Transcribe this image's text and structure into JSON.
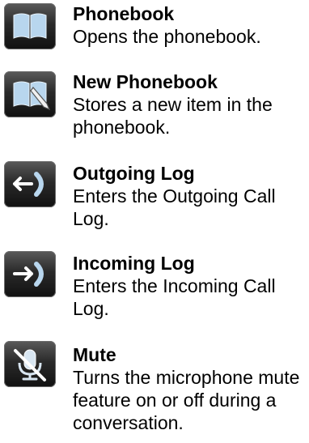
{
  "items": [
    {
      "title": "Phonebook",
      "desc": "Opens the phonebook.",
      "icon": "book-icon"
    },
    {
      "title": "New Phonebook",
      "desc": "Stores a new item in the phonebook.",
      "icon": "book-pencil-icon"
    },
    {
      "title": "Outgoing Log",
      "desc": "Enters the Outgoing Call Log.",
      "icon": "outgoing-call-icon"
    },
    {
      "title": "Incoming Log",
      "desc": "Enters the Incoming Call Log.",
      "icon": "incoming-call-icon"
    },
    {
      "title": "Mute",
      "desc": "Turns the microphone mute feature on or off during a conversation.",
      "icon": "mute-microphone-icon"
    }
  ],
  "colors": {
    "icon_bg": "#2a2a2a",
    "icon_accent": "#b8d6ee"
  }
}
